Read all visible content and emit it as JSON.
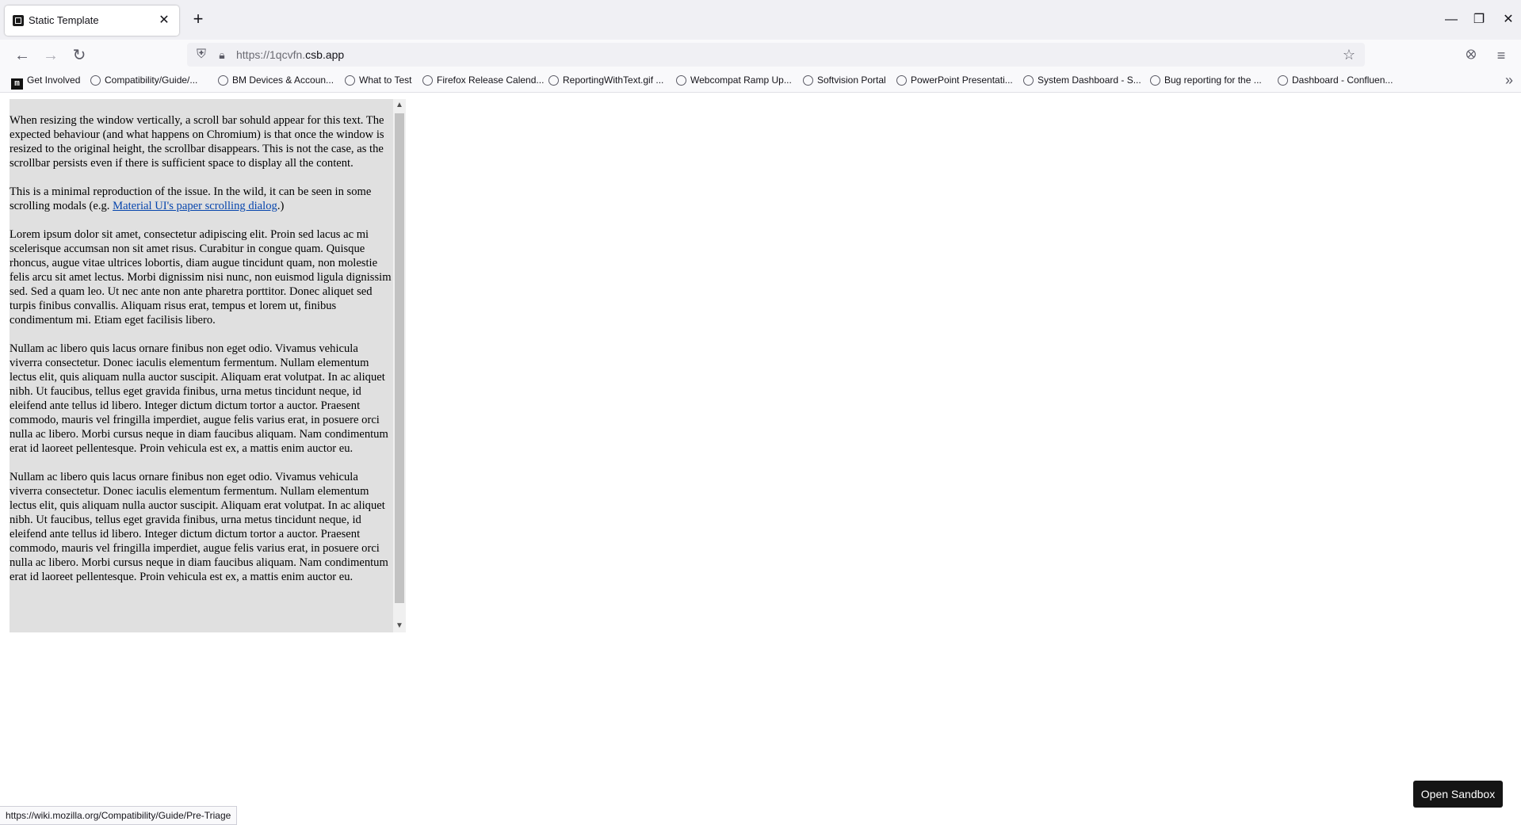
{
  "browser": {
    "tab": {
      "title": "Static Template",
      "close": "✕"
    },
    "new_tab": "+",
    "window_controls": {
      "minimize": "—",
      "restore": "❐",
      "close": "✕"
    },
    "nav": {
      "back": "←",
      "forward": "→",
      "reload": "↻"
    },
    "url_prefix": "https://1qcvfn.",
    "url_domain": "csb.app",
    "icons": {
      "shield": "shield-icon",
      "lock": "lock-icon",
      "star": "star-icon",
      "pocket": "pocket-icon",
      "menu": "menu-icon"
    },
    "bookmarks": [
      {
        "label": "Get Involved",
        "icon": "mdn"
      },
      {
        "label": "Compatibility/Guide/...",
        "icon": "globe"
      },
      {
        "label": "BM Devices & Accoun...",
        "icon": "globe"
      },
      {
        "label": "What to Test",
        "icon": "globe"
      },
      {
        "label": "Firefox Release Calend...",
        "icon": "globe"
      },
      {
        "label": "ReportingWithText.gif ...",
        "icon": "globe"
      },
      {
        "label": "Webcompat Ramp Up...",
        "icon": "globe"
      },
      {
        "label": "Softvision Portal",
        "icon": "globe"
      },
      {
        "label": "PowerPoint Presentati...",
        "icon": "globe"
      },
      {
        "label": "System Dashboard - S...",
        "icon": "globe"
      },
      {
        "label": "Bug reporting for the ...",
        "icon": "globe"
      },
      {
        "label": "Dashboard - Confluen...",
        "icon": "globe"
      }
    ],
    "bookmarks_more": "»",
    "status_url": "https://wiki.mozilla.org/Compatibility/Guide/Pre-Triage"
  },
  "page": {
    "p1": "When resizing the window vertically, a scroll bar sohuld appear for this text. The expected behaviour (and what happens on Chromium) is that once the window is resized to the original height, the scrollbar disappears. This is not the case, as the scrollbar persists even if there is sufficient space to display all the content.",
    "p2_before": "This is a minimal reproduction of the issue. In the wild, it can be seen in some scrolling modals (e.g. ",
    "p2_link": "Material UI's paper scrolling dialog",
    "p2_after": ".)",
    "p3": "Lorem ipsum dolor sit amet, consectetur adipiscing elit. Proin sed lacus ac mi scelerisque accumsan non sit amet risus. Curabitur in congue quam. Quisque rhoncus, augue vitae ultrices lobortis, diam augue tincidunt quam, non molestie felis arcu sit amet lectus. Morbi dignissim nisi nunc, non euismod ligula dignissim sed. Sed a quam leo. Ut nec ante non ante pharetra porttitor. Donec aliquet sed turpis finibus convallis. Aliquam risus erat, tempus et lorem ut, finibus condimentum mi. Etiam eget facilisis libero.",
    "p4": "Nullam ac libero quis lacus ornare finibus non eget odio. Vivamus vehicula viverra consectetur. Donec iaculis elementum fermentum. Nullam elementum lectus elit, quis aliquam nulla auctor suscipit. Aliquam erat volutpat. In ac aliquet nibh. Ut faucibus, tellus eget gravida finibus, urna metus tincidunt neque, id eleifend ante tellus id libero. Integer dictum dictum tortor a auctor. Praesent commodo, mauris vel fringilla imperdiet, augue felis varius erat, in posuere orci nulla ac libero. Morbi cursus neque in diam faucibus aliquam. Nam condimentum erat id laoreet pellentesque. Proin vehicula est ex, a mattis enim auctor eu.",
    "p5": "Nullam ac libero quis lacus ornare finibus non eget odio. Vivamus vehicula viverra consectetur. Donec iaculis elementum fermentum. Nullam elementum lectus elit, quis aliquam nulla auctor suscipit. Aliquam erat volutpat. In ac aliquet nibh. Ut faucibus, tellus eget gravida finibus, urna metus tincidunt neque, id eleifend ante tellus id libero. Integer dictum dictum tortor a auctor. Praesent commodo, mauris vel fringilla imperdiet, augue felis varius erat, in posuere orci nulla ac libero. Morbi cursus neque in diam faucibus aliquam. Nam condimentum erat id laoreet pellentesque. Proin vehicula est ex, a mattis enim auctor eu."
  },
  "scrollbar": {
    "up": "▲",
    "down": "▼"
  },
  "sandbox_button": "Open Sandbox",
  "colors": {
    "scroller_bg": "#e0e0e0",
    "link": "#0645ad",
    "button_bg": "#151515"
  }
}
